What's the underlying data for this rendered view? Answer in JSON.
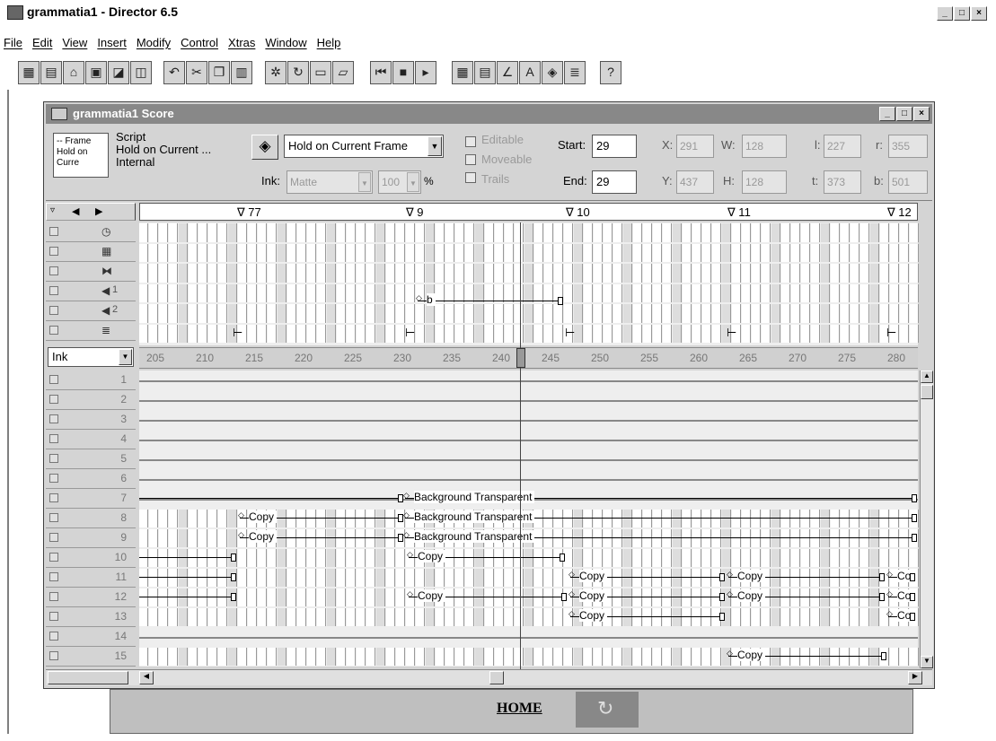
{
  "app": {
    "title": "grammatia1 - Director 6.5"
  },
  "menu": [
    "File",
    "Edit",
    "View",
    "Insert",
    "Modify",
    "Control",
    "Xtras",
    "Window",
    "Help"
  ],
  "score": {
    "title": "grammatia1 Score",
    "sprite_info": {
      "thumb_lines": [
        "-- Frame",
        "Hold on",
        "Curre"
      ],
      "type": "Script",
      "script_name": "Hold on Current ...",
      "location": "Internal",
      "behavior": "Hold on Current Frame",
      "ink_label": "Ink:",
      "ink_value": "Matte",
      "blend_value": "100",
      "percent": "%",
      "editable": "Editable",
      "moveable": "Moveable",
      "trails": "Trails",
      "start_label": "Start:",
      "start_value": "29",
      "end_label": "End:",
      "end_value": "29",
      "x_label": "X:",
      "x_value": "291",
      "y_label": "Y:",
      "y_value": "437",
      "w_label": "W:",
      "w_value": "128",
      "h_label": "H:",
      "h_value": "128",
      "l_label": "l:",
      "l_value": "227",
      "t_label": "t:",
      "t_value": "373",
      "r_label": "r:",
      "r_value": "355",
      "b_label": "b:",
      "b_value": "501"
    },
    "markers": [
      "∇ 77",
      "∇ 9",
      "∇ 10",
      "∇ 11",
      "∇ 12"
    ],
    "ruler_mode": "Ink",
    "ruler": [
      "205",
      "210",
      "215",
      "220",
      "225",
      "230",
      "235",
      "240",
      "245",
      "250",
      "255",
      "260",
      "265",
      "270",
      "275",
      "280"
    ],
    "channel_numbers": [
      "1",
      "2",
      "3",
      "4",
      "5",
      "6",
      "7",
      "8",
      "9",
      "10",
      "11",
      "12",
      "13",
      "14",
      "15"
    ],
    "sound1_label": "1",
    "sound2_label": "2",
    "sprites": {
      "b": "b",
      "bg": "Background Transparent",
      "copy": "Copy",
      "co": "Co"
    }
  },
  "stage": {
    "home": "HOME"
  }
}
